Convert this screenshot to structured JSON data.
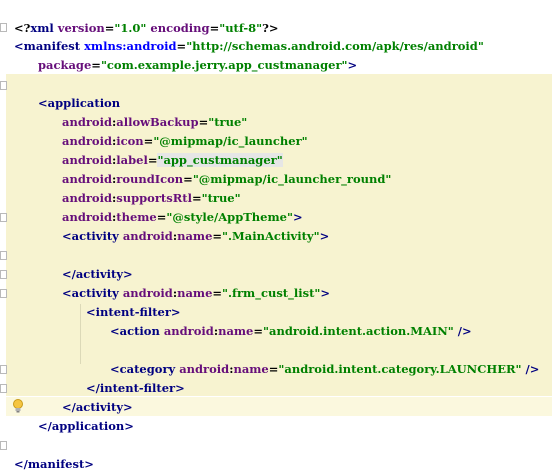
{
  "code_lines": [
    "<?xml version=\"1.0\" encoding=\"utf-8\"?>",
    "<manifest xmlns:android=\"http://schemas.android.com/apk/res/android\"",
    "package=\"com.example.jerry.app_custmanager\">",
    "<application",
    "android:allowBackup=\"true\"",
    "android:icon=\"@mipmap/ic_launcher\"",
    "android:label=\"app_custmanager\"",
    "android:roundIcon=\"@mipmap/ic_launcher_round\"",
    "android:supportsRtl=\"true\"",
    "android:theme=\"@style/AppTheme\">",
    "<activity android:name=\".MainActivity\">",
    "</activity>",
    "<activity android:name=\".frm_cust_list\">",
    "<intent-filter>",
    "<action android:name=\"android.intent.action.MAIN\" />",
    "<category android:name=\"android.intent.category.LAUNCHER\" />",
    "</intent-filter>",
    "</activity>",
    "</application>",
    "</manifest>"
  ],
  "tokens": {
    "l1": [
      "<?",
      "xml ",
      "version",
      "=",
      "\"1.0\"",
      " ",
      "encoding",
      "=",
      "\"utf-8\"",
      "?>"
    ],
    "l2": [
      "<",
      "manifest ",
      "xmlns:",
      "android",
      "=",
      "\"http://schemas.android.com/apk/res/android\""
    ],
    "l3": [
      "package",
      "=",
      "\"com.example.jerry.app_custmanager\"",
      ">"
    ],
    "l4": [
      "<",
      "application"
    ],
    "l5": [
      "android",
      ":",
      "allowBackup",
      "=",
      "\"true\""
    ],
    "l6": [
      "android",
      ":",
      "icon",
      "=",
      "\"@mipmap/ic_launcher\""
    ],
    "l7": [
      "android",
      ":",
      "label",
      "=",
      "\"app_custmanager\""
    ],
    "l8": [
      "android",
      ":",
      "roundIcon",
      "=",
      "\"@mipmap/ic_launcher_round\""
    ],
    "l9": [
      "android",
      ":",
      "supportsRtl",
      "=",
      "\"true\""
    ],
    "l10": [
      "android",
      ":",
      "theme",
      "=",
      "\"@style/AppTheme\"",
      ">"
    ],
    "l11": [
      "<",
      "activity ",
      "android",
      ":",
      "name",
      "=",
      "\".MainActivity\"",
      ">"
    ],
    "l12": [
      "</",
      "activity",
      ">"
    ],
    "l13": [
      "<",
      "activity ",
      "android",
      ":",
      "name",
      "=",
      "\".frm_cust_list\"",
      ">"
    ],
    "l14": [
      "<",
      "intent-filter",
      ">"
    ],
    "l15": [
      "<",
      "action ",
      "android",
      ":",
      "name",
      "=",
      "\"android.intent.action.MAIN\"",
      " />"
    ],
    "l16": [
      "<",
      "category ",
      "android",
      ":",
      "name",
      "=",
      "\"android.intent.category.LAUNCHER\"",
      " />"
    ],
    "l17": [
      "</",
      "intent-filter",
      ">"
    ],
    "l18": [
      "</",
      "activity",
      ">"
    ],
    "l19": [
      "</",
      "application",
      ">"
    ],
    "l20": [
      "</",
      "manifest",
      ">"
    ]
  },
  "colors": {
    "tag": "#000080",
    "attribute": "#660e7a",
    "namespace": "#0000ff",
    "value": "#008000",
    "highlight_band": "#f7f3d0"
  },
  "icons": {
    "intention": "lightbulb-icon",
    "fold": "fold-marker-icon"
  }
}
